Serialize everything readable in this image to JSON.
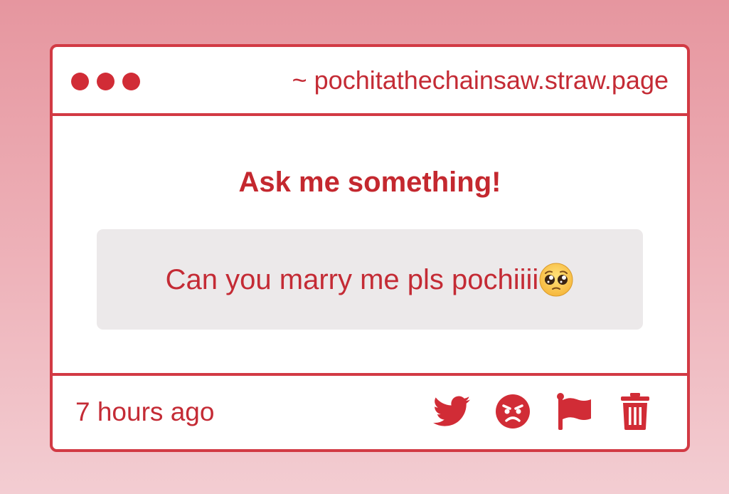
{
  "window": {
    "url": "~ pochitathechainsaw.straw.page"
  },
  "main": {
    "heading": "Ask me something!",
    "question": "Can you marry me pls pochiiii",
    "question_emoji": "pleading-face-emoji"
  },
  "footer": {
    "timestamp": "7 hours ago",
    "actions": [
      {
        "icon": "twitter-icon"
      },
      {
        "icon": "angry-face-icon"
      },
      {
        "icon": "flag-icon"
      },
      {
        "icon": "trash-icon"
      }
    ]
  },
  "colors": {
    "accent": "#d12c36",
    "question_background": "#ece9ea",
    "card_background": "#ffffff"
  }
}
